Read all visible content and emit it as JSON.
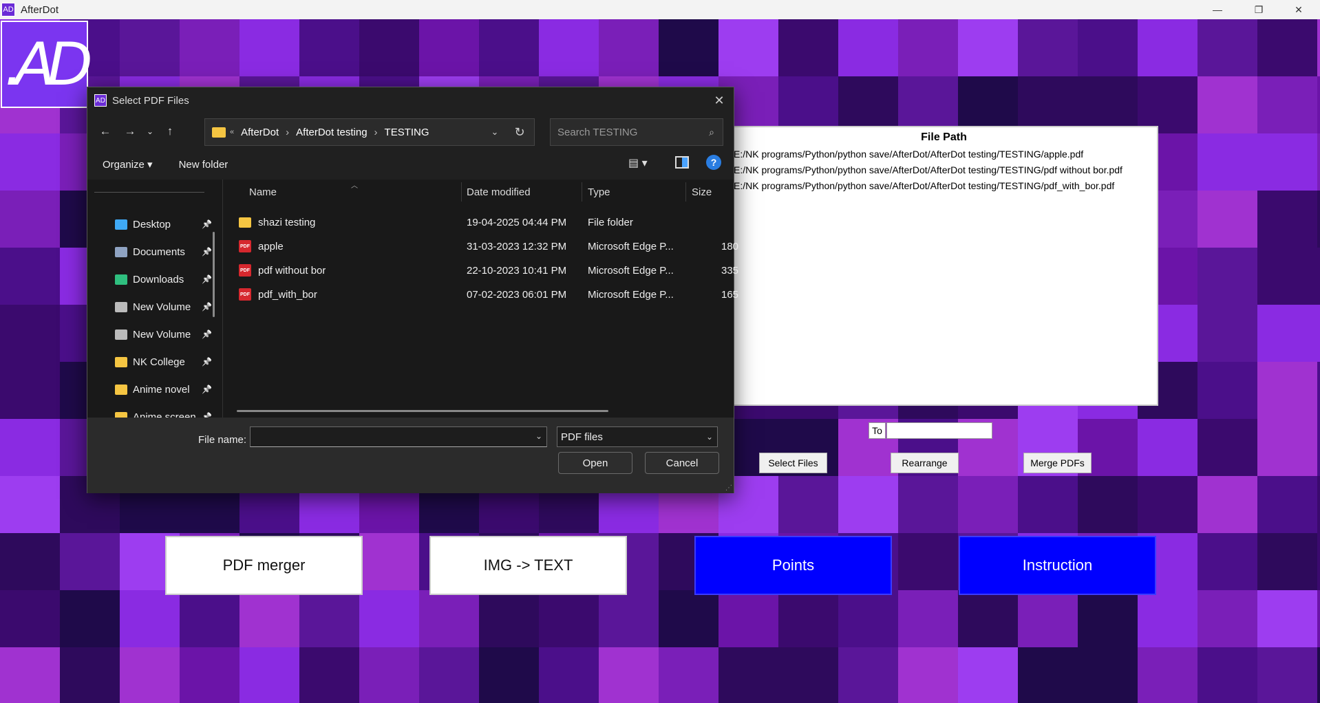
{
  "app": {
    "title": "AfterDot",
    "logo_text": ".AD",
    "window_controls": {
      "minimize": "—",
      "maximize": "❐",
      "close": "✕"
    }
  },
  "file_panel": {
    "title": "File Path",
    "paths": [
      "E:/NK programs/Python/python save/AfterDot/AfterDot testing/TESTING/apple.pdf",
      "E:/NK programs/Python/python save/AfterDot/AfterDot testing/TESTING/pdf without bor.pdf",
      "E:/NK programs/Python/python save/AfterDot/AfterDot testing/TESTING/pdf_with_bor.pdf"
    ]
  },
  "controls": {
    "to_label": "To",
    "to_value": "",
    "select_files": "Select Files",
    "rearrange": "Rearrange",
    "merge_pdfs": "Merge PDFs"
  },
  "main_buttons": {
    "pdf_merger": "PDF merger",
    "img_to_text": "IMG -> TEXT",
    "points": "Points",
    "instruction": "Instruction"
  },
  "dialog": {
    "title": "Select PDF Files",
    "breadcrumb": [
      "AfterDot",
      "AfterDot testing",
      "TESTING"
    ],
    "search_placeholder": "Search TESTING",
    "organize": "Organize",
    "new_folder": "New folder",
    "nav_items": [
      {
        "label": "Desktop",
        "icon": "desktop-icon",
        "color": "#3fa9f5"
      },
      {
        "label": "Documents",
        "icon": "documents-icon",
        "color": "#8fa3c2"
      },
      {
        "label": "Downloads",
        "icon": "downloads-icon",
        "color": "#2fbf7f"
      },
      {
        "label": "New Volume",
        "icon": "drive-icon",
        "color": "#bbbbbb"
      },
      {
        "label": "New Volume",
        "icon": "drive-icon",
        "color": "#bbbbbb"
      },
      {
        "label": "NK College",
        "icon": "folder-icon",
        "color": "#f5c542"
      },
      {
        "label": "Anime novel",
        "icon": "folder-icon",
        "color": "#f5c542"
      },
      {
        "label": "Anime screen",
        "icon": "folder-icon",
        "color": "#f5c542"
      }
    ],
    "columns": {
      "name": "Name",
      "date": "Date modified",
      "type": "Type",
      "size": "Size"
    },
    "files": [
      {
        "name": "shazi testing",
        "date": "19-04-2025 04:44 PM",
        "type": "File folder",
        "size": "",
        "icon": "folder-icon"
      },
      {
        "name": "apple",
        "date": "31-03-2023 12:32 PM",
        "type": "Microsoft Edge P...",
        "size": "180",
        "icon": "pdf-icon"
      },
      {
        "name": "pdf without bor",
        "date": "22-10-2023 10:41 PM",
        "type": "Microsoft Edge P...",
        "size": "335",
        "icon": "pdf-icon"
      },
      {
        "name": "pdf_with_bor",
        "date": "07-02-2023 06:01 PM",
        "type": "Microsoft Edge P...",
        "size": "165",
        "icon": "pdf-icon"
      }
    ],
    "file_name_label": "File name:",
    "file_name_value": "",
    "file_type": "PDF files",
    "open": "Open",
    "cancel": "Cancel"
  },
  "colors": {
    "accent_blue": "#0000ff",
    "folder": "#f5c542",
    "pdf_red": "#d6282e",
    "tile_palette": [
      "#3b0a6e",
      "#5a1699",
      "#7a1fb8",
      "#2e0a5c",
      "#8a2be2",
      "#4b0f8a",
      "#9d3df0",
      "#1f0a4a",
      "#6b14a8",
      "#a032d0"
    ]
  }
}
